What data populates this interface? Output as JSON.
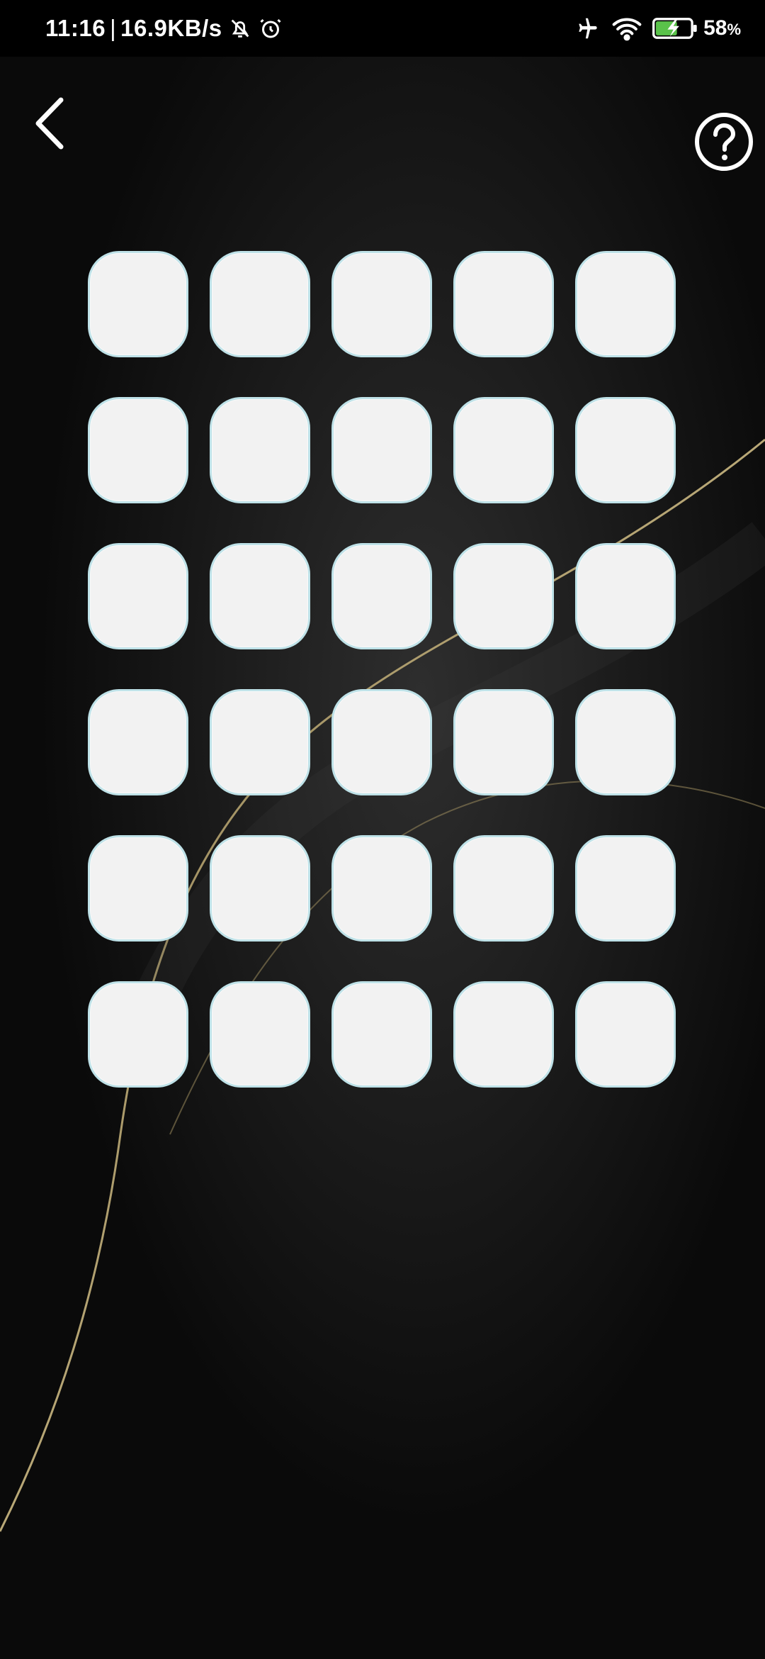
{
  "status_bar": {
    "time": "11:16",
    "separator": "|",
    "network_speed": "16.9KB/s",
    "battery_level": "58",
    "battery_unit": "%",
    "icons": [
      "muted-bell-icon",
      "alarm-icon",
      "airplane-mode-icon",
      "wifi-icon",
      "battery-charging-icon"
    ]
  },
  "nav": {
    "back_icon": "chevron-left-icon",
    "help_icon": "question-circle-icon"
  },
  "grid": {
    "rows": 6,
    "columns": 5,
    "tile_color": "#f2f2f2",
    "tile_border_color": "#bfe2e8"
  },
  "colors": {
    "background": "#0b0b0b",
    "accent_line": "#b9a46a",
    "battery_fill": "#5ac24a"
  }
}
